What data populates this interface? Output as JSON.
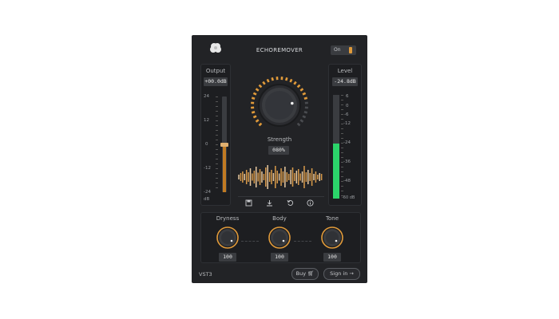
{
  "header": {
    "title": "ECHOREMOVER",
    "power_label": "On"
  },
  "output": {
    "label": "Output",
    "value": "+00.0dB",
    "ticks": [
      "24",
      "12",
      "0",
      "-12",
      "-24"
    ],
    "unit": "dB",
    "fader_level": 0.5
  },
  "level": {
    "label": "Level",
    "value": "-24.8dB",
    "ticks": [
      "6",
      "0",
      "-6",
      "-12",
      "-24",
      "-36",
      "-48",
      "-60 dB"
    ],
    "meter_fill": 0.53
  },
  "strength": {
    "label": "Strength",
    "value": "080%",
    "level": 0.8
  },
  "toolbar": {
    "icons": [
      "save-icon",
      "download-icon",
      "undo-icon",
      "info-icon"
    ]
  },
  "knobs": [
    {
      "label": "Dryness",
      "value": "100"
    },
    {
      "label": "Body",
      "value": "100"
    },
    {
      "label": "Tone",
      "value": "100"
    }
  ],
  "footer": {
    "format": "VST3",
    "buy_label": "Buy",
    "signin_label": "Sign in"
  },
  "colors": {
    "accent": "#e09a3a",
    "meter_green": "#2bd46a",
    "panel": "#222326"
  }
}
